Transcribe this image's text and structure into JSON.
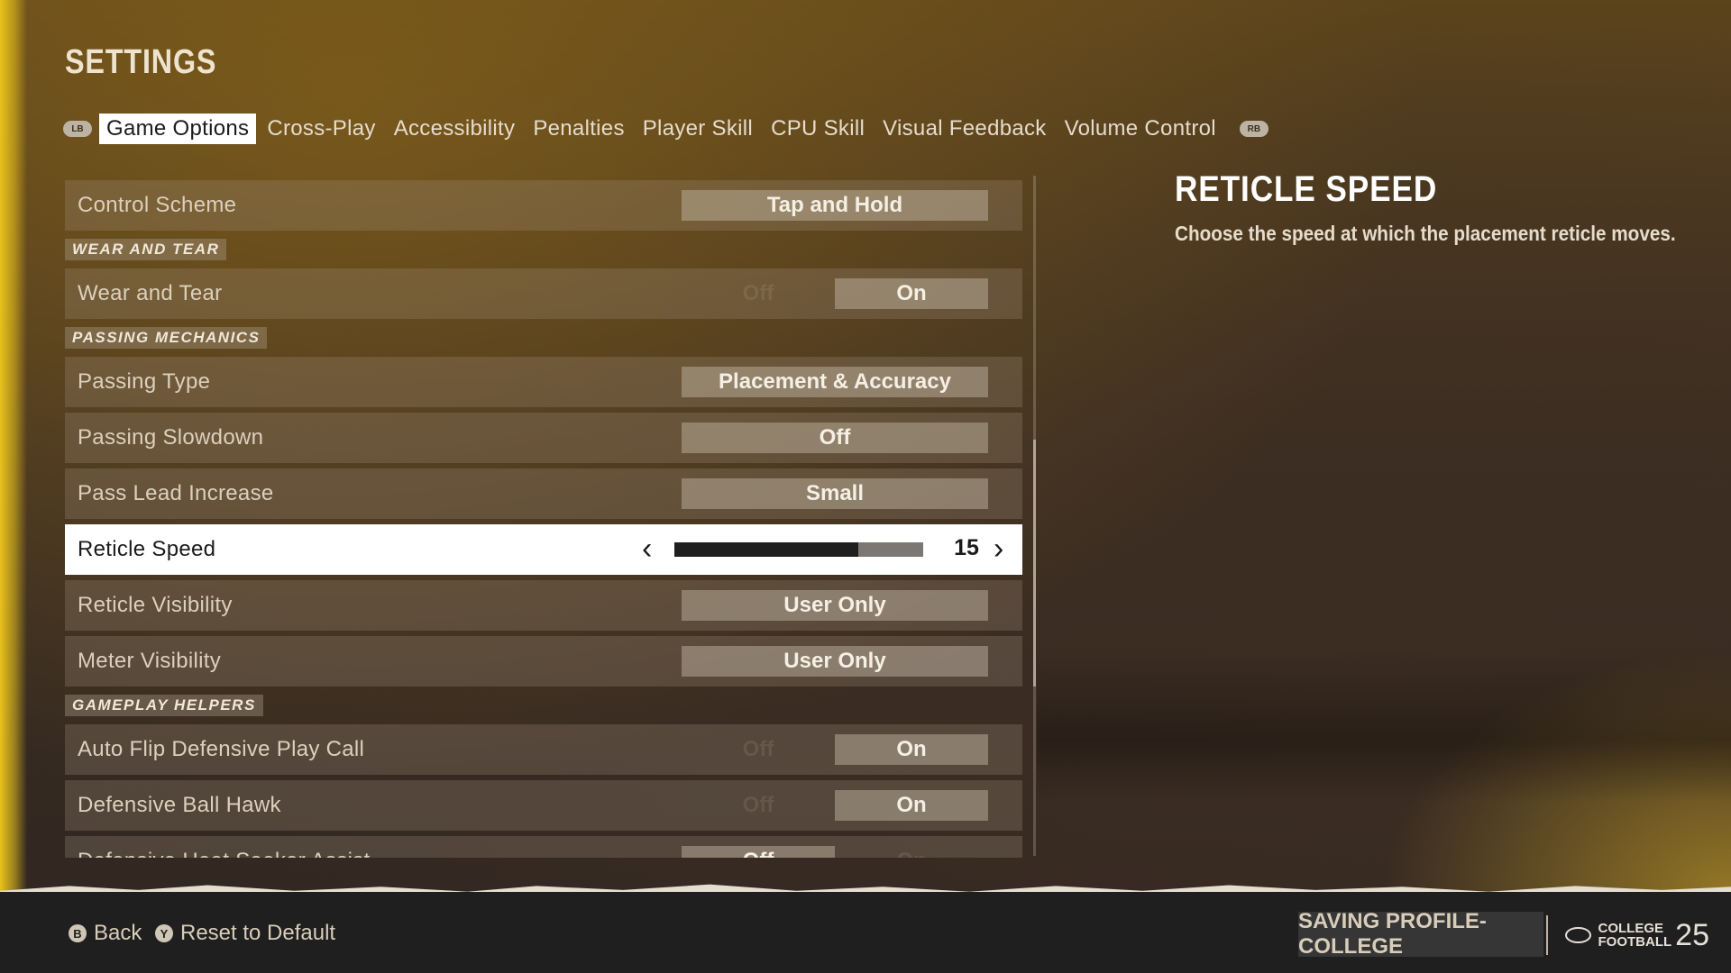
{
  "page": {
    "title": "SETTINGS"
  },
  "tabs": {
    "left_bumper": "LB",
    "right_bumper": "RB",
    "items": [
      {
        "label": "Game Options",
        "active": true
      },
      {
        "label": "Cross-Play",
        "active": false
      },
      {
        "label": "Accessibility",
        "active": false
      },
      {
        "label": "Penalties",
        "active": false
      },
      {
        "label": "Player Skill",
        "active": false
      },
      {
        "label": "CPU Skill",
        "active": false
      },
      {
        "label": "Visual Feedback",
        "active": false
      },
      {
        "label": "Volume Control",
        "active": false
      }
    ]
  },
  "settings": {
    "control_scheme": {
      "label": "Control Scheme",
      "value": "Tap and Hold"
    },
    "sections": {
      "wear_and_tear": "WEAR AND TEAR",
      "passing_mechanics": "PASSING MECHANICS",
      "gameplay_helpers": "GAMEPLAY HELPERS"
    },
    "wear_and_tear": {
      "label": "Wear and Tear",
      "off_label": "Off",
      "on_label": "On",
      "selected": "On"
    },
    "passing_type": {
      "label": "Passing Type",
      "value": "Placement & Accuracy"
    },
    "passing_slowdown": {
      "label": "Passing Slowdown",
      "value": "Off"
    },
    "pass_lead_increase": {
      "label": "Pass Lead Increase",
      "value": "Small"
    },
    "reticle_speed": {
      "label": "Reticle Speed",
      "value": "15",
      "fill_fraction": 0.74
    },
    "reticle_visibility": {
      "label": "Reticle Visibility",
      "value": "User Only"
    },
    "meter_visibility": {
      "label": "Meter Visibility",
      "value": "User Only"
    },
    "auto_flip": {
      "label": "Auto Flip Defensive Play Call",
      "off_label": "Off",
      "on_label": "On",
      "selected": "On"
    },
    "ball_hawk": {
      "label": "Defensive Ball Hawk",
      "off_label": "Off",
      "on_label": "On",
      "selected": "On"
    },
    "heat_seeker": {
      "label": "Defensive Heat Seeker Assist",
      "off_label": "Off",
      "on_label": "On",
      "selected": "Off"
    }
  },
  "detail": {
    "title": "RETICLE SPEED",
    "description": "Choose the speed at which the placement reticle moves."
  },
  "footer": {
    "back_glyph": "B",
    "back_label": "Back",
    "reset_glyph": "Y",
    "reset_label": "Reset to Default",
    "save_status": "SAVING PROFILE-COLLEGE",
    "logo_line1": "COLLEGE",
    "logo_line2": "FOOTBALL",
    "logo_number": "25"
  },
  "colors": {
    "accent_yellow": "#e9c21b",
    "selected_row": "#ffffff",
    "footer_bg": "#1f1f20"
  }
}
